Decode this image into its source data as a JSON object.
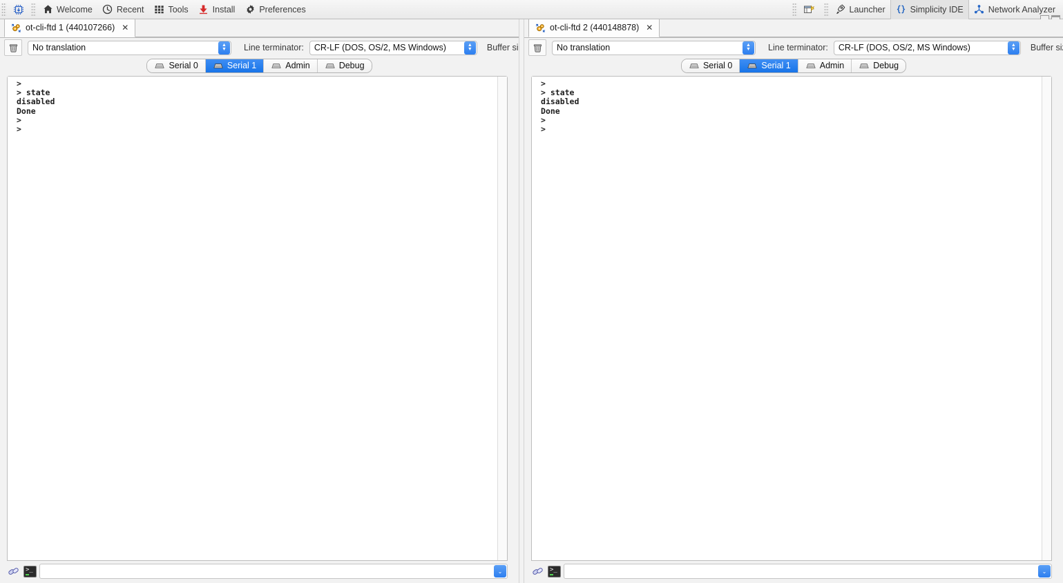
{
  "toolbar": {
    "left_items": [
      {
        "label": "Welcome",
        "icon": "home-icon"
      },
      {
        "label": "Recent",
        "icon": "clock-icon"
      },
      {
        "label": "Tools",
        "icon": "grid-icon"
      },
      {
        "label": "Install",
        "icon": "download-icon"
      },
      {
        "label": "Preferences",
        "icon": "gear-icon"
      }
    ],
    "chip_button_icon": "chip-icon",
    "right_items": [
      {
        "label": "",
        "icon": "new-perspective-icon",
        "selected": false
      },
      {
        "label": "Launcher",
        "icon": "launcher-rocket-icon",
        "selected": false
      },
      {
        "label": "Simplicity IDE",
        "icon": "braces-icon",
        "selected": true
      },
      {
        "label": "Network Analyzer",
        "icon": "network-analyzer-icon",
        "selected": false
      }
    ],
    "window_buttons": [
      "minimize",
      "maximize"
    ]
  },
  "accent_color": "#1874e8",
  "panes": [
    {
      "tab": {
        "title": "ot-cli-ftd 1 (440107266)",
        "icon": "gears-icon",
        "close_glyph": "✕"
      },
      "controls": {
        "trash_icon": "trash-icon",
        "translation": {
          "value": "No translation",
          "label": ""
        },
        "line_terminator_label": "Line terminator:",
        "line_terminator": {
          "value": "CR-LF  (DOS, OS/2, MS Windows)"
        },
        "buffer_size_label": "Buffer size"
      },
      "serial_tabs": [
        {
          "label": "Serial 0",
          "active": false,
          "icon": "serial-icon"
        },
        {
          "label": "Serial 1",
          "active": true,
          "icon": "serial-icon"
        },
        {
          "label": "Admin",
          "active": false,
          "icon": "serial-icon"
        },
        {
          "label": "Debug",
          "active": false,
          "icon": "serial-icon"
        }
      ],
      "terminal_text": ">\n> state\ndisabled\nDone\n>\n>",
      "input": {
        "value": "",
        "placeholder": "",
        "link_icon": "link-icon",
        "terminal_icon": "terminal-icon",
        "dropdown_glyph": "⌄"
      }
    },
    {
      "tab": {
        "title": "ot-cli-ftd 2 (440148878)",
        "icon": "gears-icon",
        "close_glyph": "✕"
      },
      "controls": {
        "trash_icon": "trash-icon",
        "translation": {
          "value": "No translation",
          "label": ""
        },
        "line_terminator_label": "Line terminator:",
        "line_terminator": {
          "value": "CR-LF  (DOS, OS/2, MS Windows)"
        },
        "buffer_size_label": "Buffer size"
      },
      "serial_tabs": [
        {
          "label": "Serial 0",
          "active": false,
          "icon": "serial-icon"
        },
        {
          "label": "Serial 1",
          "active": true,
          "icon": "serial-icon"
        },
        {
          "label": "Admin",
          "active": false,
          "icon": "serial-icon"
        },
        {
          "label": "Debug",
          "active": false,
          "icon": "serial-icon"
        }
      ],
      "terminal_text": ">\n> state\ndisabled\nDone\n>\n>",
      "input": {
        "value": "",
        "placeholder": "",
        "link_icon": "link-icon",
        "terminal_icon": "terminal-icon",
        "dropdown_glyph": "⌄"
      }
    }
  ]
}
